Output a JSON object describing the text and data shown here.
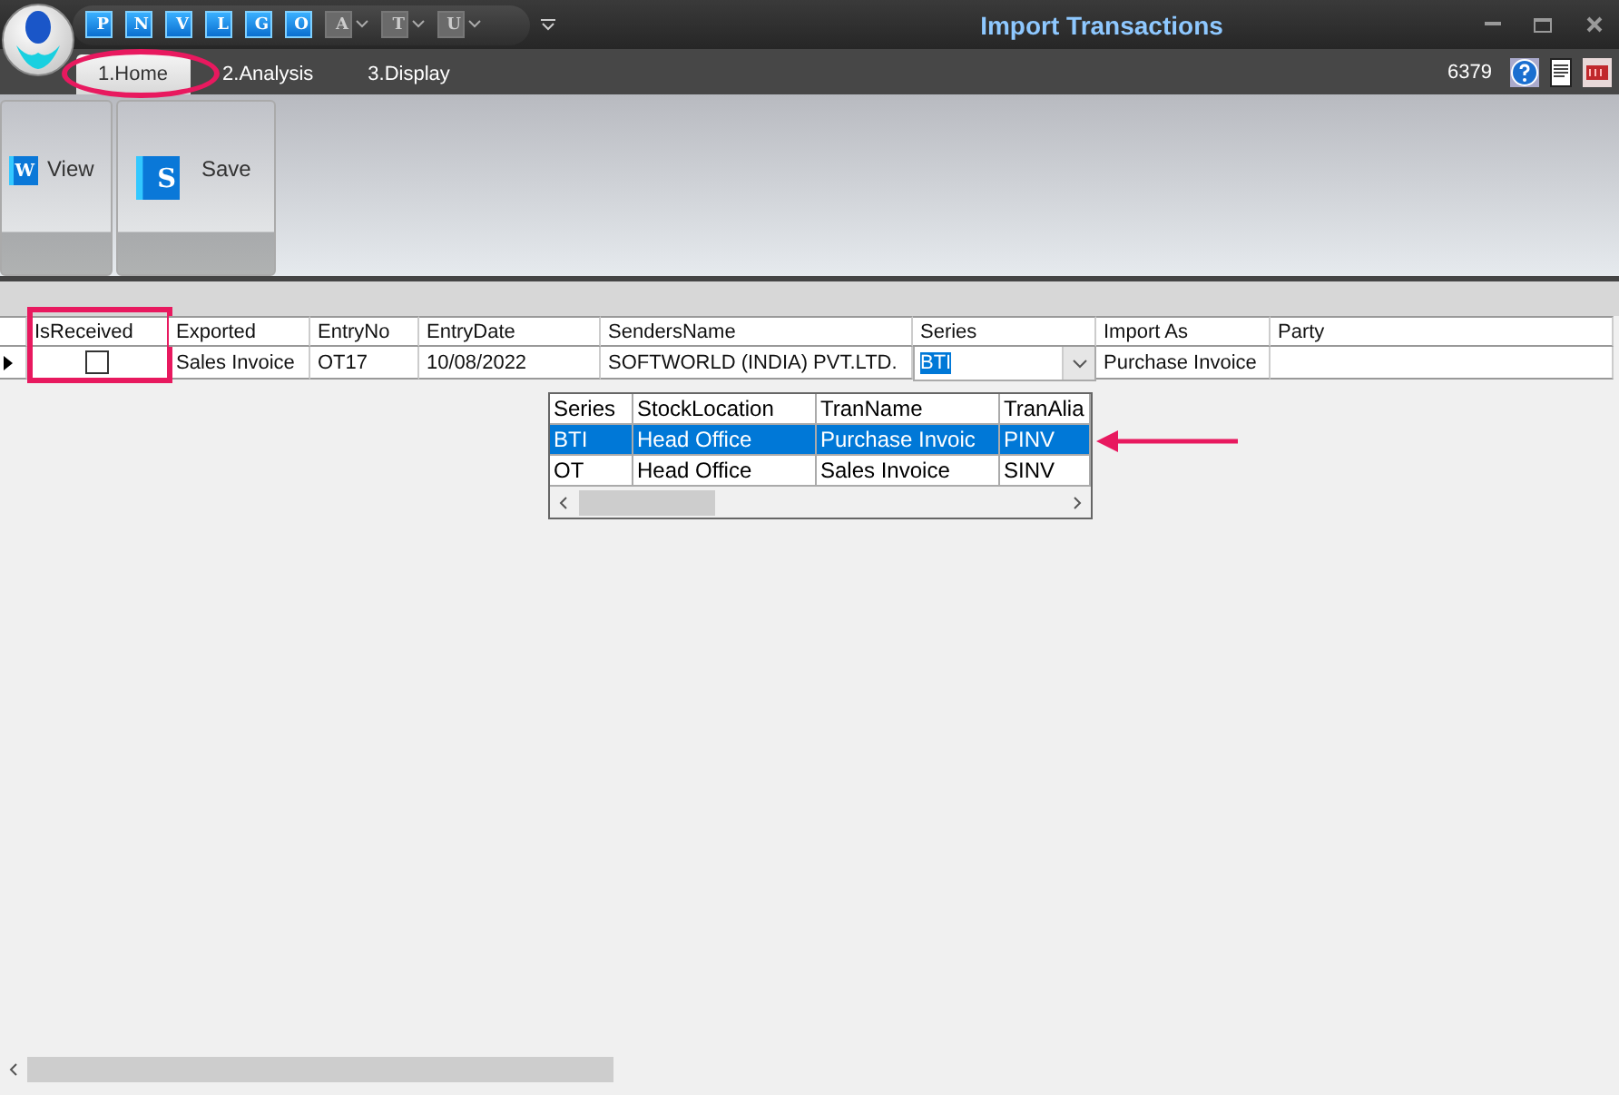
{
  "window": {
    "title": "Import Transactions"
  },
  "quick_access": [
    {
      "label": "P",
      "enabled": true,
      "dropdown": false
    },
    {
      "label": "N",
      "enabled": true,
      "dropdown": false
    },
    {
      "label": "V",
      "enabled": true,
      "dropdown": false
    },
    {
      "label": "L",
      "enabled": true,
      "dropdown": false
    },
    {
      "label": "G",
      "enabled": true,
      "dropdown": false
    },
    {
      "label": "O",
      "enabled": true,
      "dropdown": false
    },
    {
      "label": "A",
      "enabled": false,
      "dropdown": true
    },
    {
      "label": "T",
      "enabled": false,
      "dropdown": true
    },
    {
      "label": "U",
      "enabled": false,
      "dropdown": true
    }
  ],
  "tabs": [
    {
      "label": "1.Home",
      "selected": true,
      "circled": true
    },
    {
      "label": "2.Analysis",
      "selected": false,
      "circled": false
    },
    {
      "label": "3.Display",
      "selected": false,
      "circled": false
    }
  ],
  "user_code": "6379",
  "ribbon": {
    "buttons": [
      {
        "label": "View",
        "glyph": "W"
      },
      {
        "label": "Save",
        "glyph": "S"
      }
    ]
  },
  "grid": {
    "columns": [
      {
        "label": "IsReceived",
        "boxed": true
      },
      {
        "label": "Exported",
        "boxed": false
      },
      {
        "label": "EntryNo",
        "boxed": false
      },
      {
        "label": "EntryDate",
        "boxed": false
      },
      {
        "label": "SendersName",
        "boxed": false
      },
      {
        "label": "Series",
        "boxed": false
      },
      {
        "label": "Import As",
        "boxed": false
      },
      {
        "label": "Party",
        "boxed": false
      }
    ],
    "rows": [
      {
        "current": true,
        "is_received": false,
        "exported": "Sales Invoice",
        "entry_no": "OT17",
        "entry_date": "10/08/2022",
        "senders_name": "SOFTWORLD (INDIA) PVT.LTD.",
        "series": "BTI",
        "import_as": "Purchase Invoice"
      }
    ]
  },
  "series_dropdown": {
    "columns": [
      "Series",
      "StockLocation",
      "TranName",
      "TranAlia"
    ],
    "rows": [
      {
        "cells": [
          "BTI",
          "Head Office",
          "Purchase Invoic",
          "PINV"
        ],
        "selected": true,
        "arrow": true
      },
      {
        "cells": [
          "OT",
          "Head Office",
          "Sales Invoice",
          "SINV"
        ],
        "selected": false,
        "arrow": false
      }
    ]
  }
}
